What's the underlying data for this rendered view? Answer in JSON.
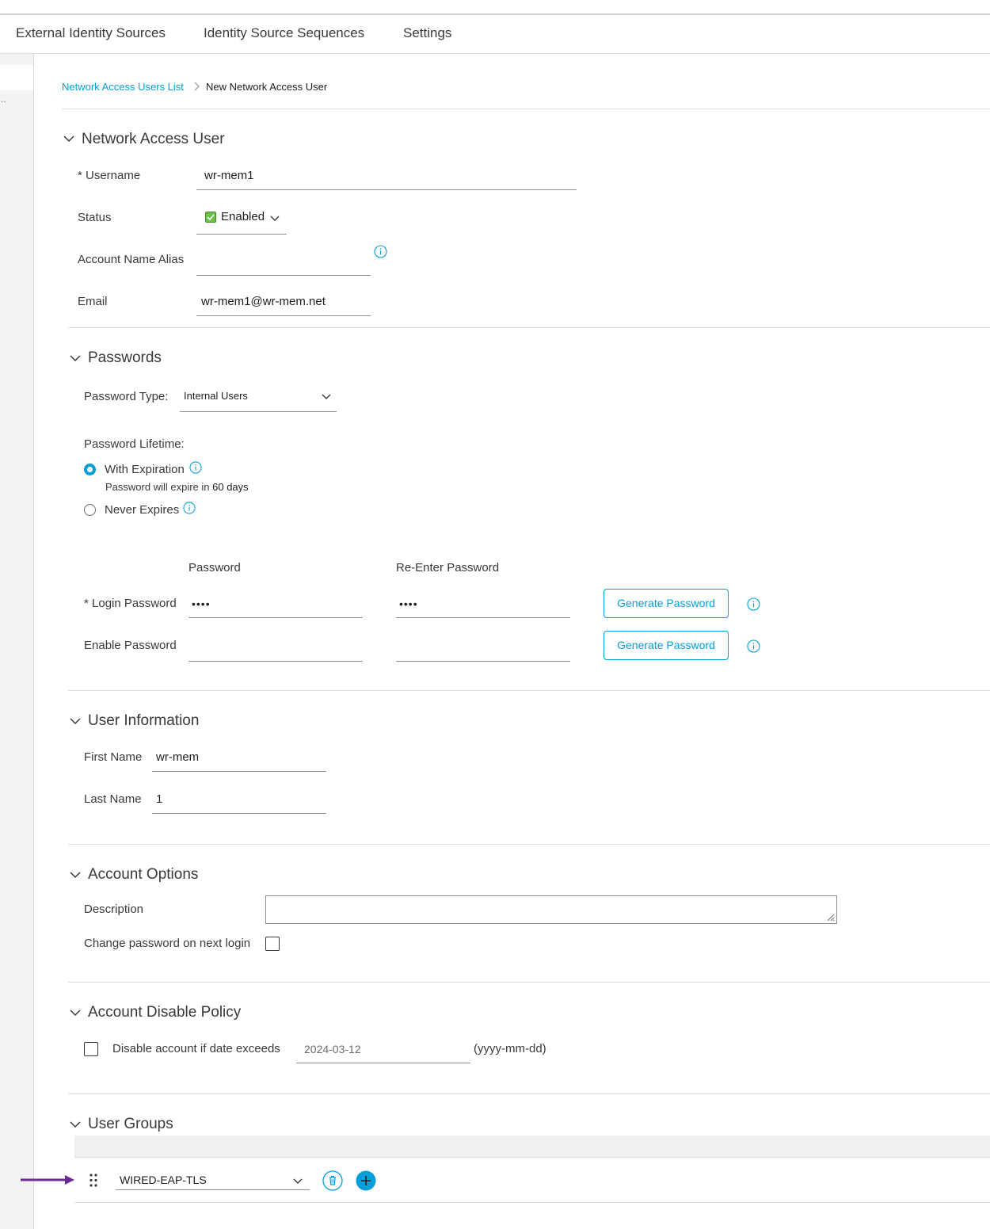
{
  "tabs": [
    {
      "label": "External Identity Sources"
    },
    {
      "label": "Identity Source Sequences"
    },
    {
      "label": "Settings"
    }
  ],
  "left_panel": {
    "truncated_text": ".."
  },
  "breadcrumb": {
    "parent": "Network Access Users List",
    "current": "New Network Access User"
  },
  "network_access_user": {
    "title": "Network Access User",
    "username_label": "* Username",
    "username_value": "wr-mem1",
    "status_label": "Status",
    "status_value": "Enabled",
    "alias_label": "Account Name Alias",
    "alias_value": "",
    "email_label": "Email",
    "email_value": "wr-mem1@wr-mem.net"
  },
  "passwords": {
    "title": "Passwords",
    "type_label": "Password Type:",
    "type_value": "Internal Users",
    "lifetime_label": "Password Lifetime:",
    "with_expiration_label": "With Expiration",
    "expire_prefix": "Password will expire in",
    "expire_days": "60 days",
    "never_expires_label": "Never Expires",
    "col_password": "Password",
    "col_reenter": "Re-Enter Password",
    "login_label": "* Login Password",
    "login_value": "••••",
    "login_reenter_value": "••••",
    "enable_label": "Enable Password",
    "enable_value": "",
    "enable_reenter_value": "",
    "generate_label": "Generate Password"
  },
  "user_information": {
    "title": "User Information",
    "first_name_label": "First Name",
    "first_name_value": "wr-mem",
    "last_name_label": "Last Name",
    "last_name_value": "1"
  },
  "account_options": {
    "title": "Account Options",
    "description_label": "Description",
    "description_value": "",
    "change_password_label": "Change password on next login",
    "change_password_checked": false
  },
  "account_disable_policy": {
    "title": "Account Disable Policy",
    "disable_label": "Disable account if date exceeds",
    "date_value": "2024-03-12",
    "date_format": "(yyyy-mm-dd)",
    "checked": false
  },
  "user_groups": {
    "title": "User Groups",
    "group_value": "WIRED-EAP-TLS"
  },
  "colors": {
    "accent": "#049fd9",
    "enabled_green": "#6cc04a",
    "annotation_arrow": "#6a2c91",
    "text": "#39393b"
  },
  "icons": {
    "chevron": "chevron-down-icon",
    "info": "info-icon",
    "drag": "drag-handle-icon",
    "trash": "trash-icon",
    "add": "plus-icon",
    "enabled": "check-icon"
  }
}
